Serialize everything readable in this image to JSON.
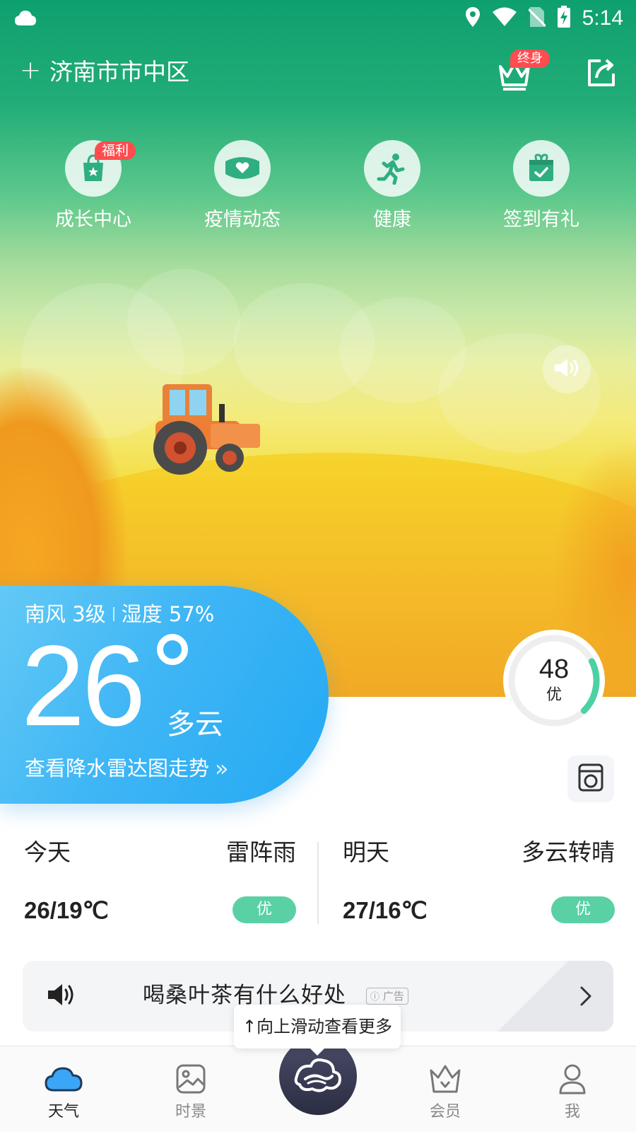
{
  "status_bar": {
    "time": "5:14",
    "left_icon": "cloud-icon",
    "icons": [
      "location-icon",
      "wifi-icon",
      "no-sim-icon",
      "battery-charging-icon"
    ]
  },
  "header": {
    "add_symbol": "+",
    "city": "济南市市中区",
    "vip_badge": "终身",
    "vip_icon": "crown-icon",
    "share_icon": "share-icon"
  },
  "quick_entries": [
    {
      "label": "成长中心",
      "icon": "bag-icon",
      "badge": "福利"
    },
    {
      "label": "疫情动态",
      "icon": "mask-icon",
      "badge": ""
    },
    {
      "label": "健康",
      "icon": "runner-icon",
      "badge": ""
    },
    {
      "label": "签到有礼",
      "icon": "gift-calendar-icon",
      "badge": ""
    }
  ],
  "current": {
    "wind": "南风 3级",
    "humidity": "湿度 57%",
    "temperature": "26",
    "condition": "多云",
    "radar_link": "查看降水雷达图走势",
    "radar_arrow": "»"
  },
  "aqi": {
    "value": "48",
    "level": "优",
    "fraction": 0.2,
    "color": "#4cd1a2"
  },
  "forecast": [
    {
      "day": "今天",
      "condition": "雷阵雨",
      "temp": "26/19℃",
      "aqi": "优"
    },
    {
      "day": "明天",
      "condition": "多云转晴",
      "temp": "27/16℃",
      "aqi": "优"
    }
  ],
  "news": {
    "title": "喝桑叶茶有什么好处",
    "ad_label": "广告"
  },
  "tooltip": "↑向上滑动查看更多",
  "bottom_nav": [
    {
      "label": "天气",
      "icon": "weather-cloud-icon",
      "active": true
    },
    {
      "label": "时景",
      "icon": "photo-icon",
      "active": false
    },
    {
      "label": "",
      "icon": "logo-icon",
      "active": false
    },
    {
      "label": "会员",
      "icon": "vip-crown-icon",
      "active": false
    },
    {
      "label": "我",
      "icon": "user-icon",
      "active": false
    }
  ],
  "colors": {
    "hero_top": "#0ea06f",
    "hero_bottom": "#ee951a",
    "card_blue": "#23a9f4",
    "aqi_green": "#5ad1a5",
    "badge_red": "#ff4d4f"
  }
}
